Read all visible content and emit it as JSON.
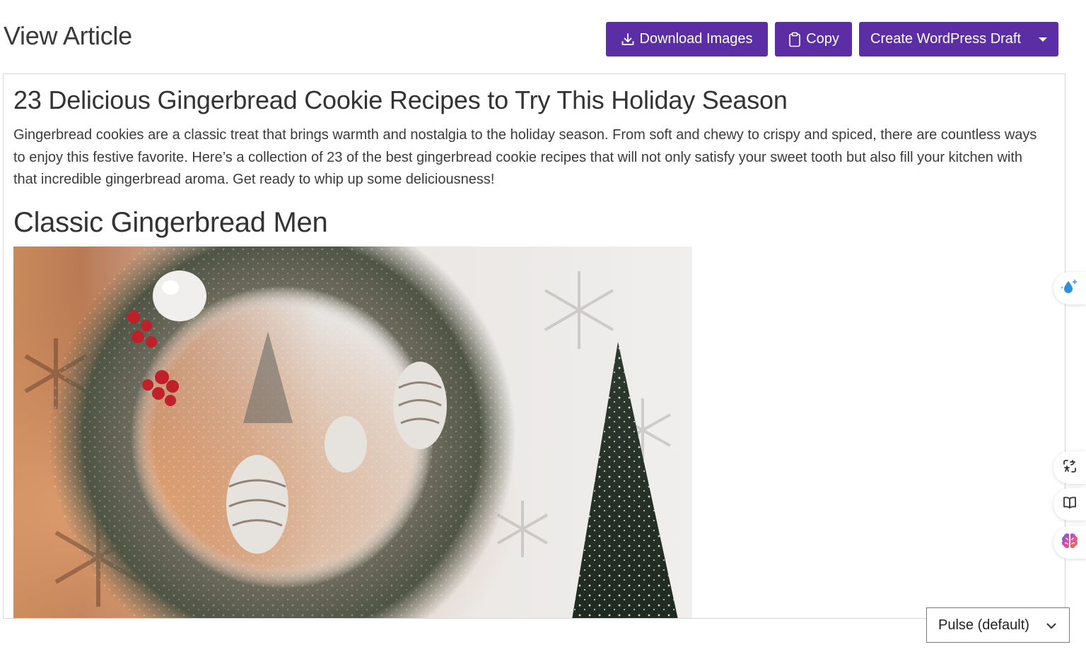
{
  "header": {
    "title": "View Article"
  },
  "toolbar": {
    "download_label": "Download Images",
    "download_icon": "download-icon",
    "copy_label": "Copy",
    "copy_icon": "clipboard-icon",
    "wordpress_label": "Create WordPress Draft",
    "wordpress_icon": "caret-down-icon",
    "button_color": "#5b2ea6"
  },
  "article": {
    "title": "23 Delicious Gingerbread Cookie Recipes to Try This Holiday Season",
    "intro": "Gingerbread cookies are a classic treat that brings warmth and nostalgia to the holiday season. From soft and chewy to crispy and spiced, there are countless ways to enjoy this festive favorite. Here’s a collection of 23 of the best gingerbread cookie recipes that will not only satisfy your sweet tooth but also fill your kitchen with that incredible gingerbread aroma. Get ready to whip up some deliciousness!",
    "sections": [
      {
        "heading": "Classic Gingerbread Men"
      }
    ]
  },
  "side_tools": [
    {
      "icon": "sparkle-droplet-icon"
    },
    {
      "icon": "translate-icon"
    },
    {
      "icon": "book-icon"
    },
    {
      "icon": "brain-icon"
    }
  ],
  "theme_select": {
    "value": "Pulse (default)",
    "icon": "chevron-down-icon"
  }
}
